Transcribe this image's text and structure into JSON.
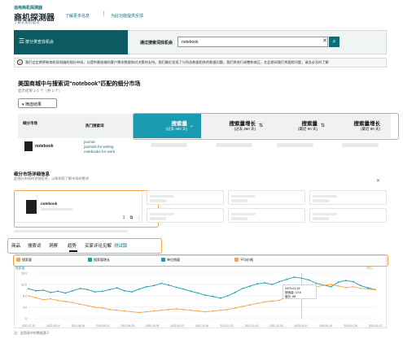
{
  "header": {
    "small_title": "适用商机探测器",
    "title": "商机探测器",
    "learn_more": "了解更多信息",
    "separator": "|",
    "feedback": "为此功能提供反馈",
    "subtitle": "了解买家的需求"
  },
  "search_bar": {
    "menu_icon": "hamburger-icon",
    "left_label": "按分类查找机会",
    "search_label": "通过搜索词找机会",
    "value": "notebook",
    "search_icon": "search-icon"
  },
  "info_banner": {
    "icon": "info-icon",
    "text": "我们会定期更新商机探测器的细分市场，以提供最准确的客户需求数据和对决策的支持。我们最近发现了与所选数据相关的数据问题，我们将进行调整和修正，在此期间我们将跟踪问题，请务必及时了解"
  },
  "market": {
    "title": "美国商城中与搜索词“notebook”匹配的细分市场",
    "subtitle": "显示结果 1-1 个（共 1 个）",
    "filter_button": "筛选结果"
  },
  "table": {
    "columns": {
      "niche": "细分市场",
      "hot_terms": "热门搜索词",
      "volume": {
        "label": "搜索量",
        "range": "(过去 360 天)"
      },
      "volume_growth": {
        "label": "搜索量增长",
        "range": "(过去 360 天)"
      },
      "volume_90": {
        "label": "搜索量",
        "range": "(最近 90 天)"
      },
      "volume_growth_90": {
        "label": "搜索量增长",
        "range": "(最近 90 天)"
      }
    },
    "row": {
      "name": "notebook",
      "keywords": [
        "journal",
        "journals for writing",
        "notebooks for work"
      ]
    }
  },
  "details": {
    "title": "细分市场详细信息",
    "subtitle": "此细分市场的详细信息，以帮助您了解市场的需求",
    "card_name": "notebook"
  },
  "tabs": [
    {
      "label": "商品",
      "active": false
    },
    {
      "label": "搜索词",
      "active": false
    },
    {
      "label": "洞察",
      "active": false
    },
    {
      "label": "趋势",
      "active": true
    },
    {
      "label": "买家评论见解",
      "active": false
    },
    {
      "label": "测试版",
      "active": false
    }
  ],
  "chart_data": {
    "type": "line",
    "legend": [
      "搜索量",
      "搜索量增长",
      "单位销量",
      "平均价格"
    ],
    "colors": {
      "search_volume": "#1a9bb0",
      "growth": "#f0a54a",
      "units": "#1a9bb0",
      "price": "#f0a54a"
    },
    "y_left_title": "搜索量",
    "y_right_title": "增长",
    "x_ticks": [
      "2022-07-31",
      "2022-08-14",
      "2022-08-28",
      "2022-09-11",
      "2022-09-25",
      "2022-10-09",
      "2022-10-23",
      "2022-11-06",
      "2022-11-20",
      "2022-12-04",
      "2022-12-18",
      "2023-01-01",
      "2023-01-15",
      "2023-01-29",
      "2023-02-12"
    ],
    "y_left_ticks": [
      "16.0",
      "12.0",
      "8.0",
      "4.0",
      "0"
    ],
    "y_left_range": [
      0,
      16
    ],
    "y_right_range": [
      0,
      120
    ],
    "series": [
      {
        "name": "搜索量",
        "axis": "left",
        "values": [
          10.5,
          9.8,
          10.0,
          9.2,
          9.6,
          9.0,
          9.8,
          10.6,
          10.2,
          9.4,
          9.6,
          10.2,
          10.8,
          9.8,
          9.4,
          10.4,
          11.2,
          11.6,
          12.4,
          11.8,
          11.0,
          10.4,
          9.6,
          9.0,
          8.2,
          7.8,
          7.2,
          8.0,
          9.2,
          10.6,
          11.4,
          12.2,
          12.6,
          12.0,
          13.0,
          13.8,
          14.6,
          14.2,
          13.6,
          12.4,
          11.8,
          11.2,
          12.8,
          13.4,
          13.0,
          11.6,
          10.8,
          10.2
        ]
      },
      {
        "name": "搜索量增长",
        "axis": "right",
        "values": [
          60,
          55,
          50,
          52,
          48,
          45,
          42,
          38,
          34,
          30,
          28,
          24,
          22,
          20,
          18,
          16,
          18,
          20,
          22,
          24,
          26,
          24,
          22,
          20,
          18,
          20,
          22,
          24,
          28,
          32,
          36,
          40,
          44,
          46,
          48,
          60,
          68,
          74,
          80,
          84,
          88,
          90,
          86,
          82,
          84,
          80,
          78,
          76
        ]
      }
    ],
    "tooltip": {
      "date": "2023-01-15",
      "line1": "搜索量: 14.6",
      "line2": "增长: 88"
    },
    "footnote": "注：此图表中的数据基于"
  }
}
